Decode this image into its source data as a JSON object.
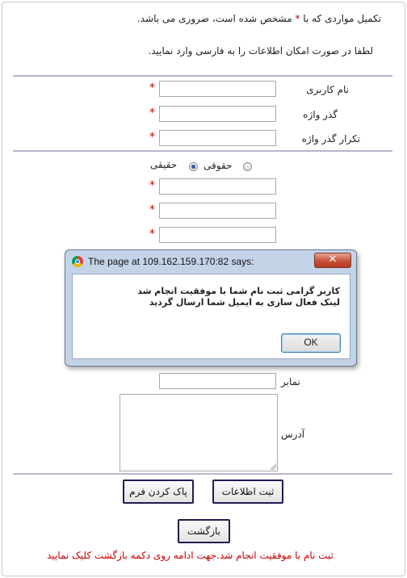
{
  "notice": {
    "line1_part1": "تکمیل مواردی که با",
    "star": "*",
    "line1_part2": "مشخص شده است، ضروری می باشد.",
    "line2": "لطفا در صورت امکان اطلاعات را به فارسی وارد نمایید."
  },
  "fields": {
    "username_label": "نام کاربری",
    "password_label": "گذر واژه",
    "password_repeat_label": "تکرار گذر واژه",
    "fax_label": "نمابر",
    "address_label": "آدرس",
    "required_mark": "*"
  },
  "person_type": {
    "legal": "حقوقی",
    "natural": "حقیقی",
    "selected": "حقیقی"
  },
  "buttons": {
    "clear": "پاک کردن فرم",
    "submit": "ثبت اطلاعات",
    "back": "بازگشت"
  },
  "status_message": "ثبت نام با موفقیت انجام شد.جهت ادامه روی دکمه بازگشت کلیک نمایید",
  "dialog": {
    "title": "The page at 109.162.159.170:82 says:",
    "close": "✕",
    "message_line1": "کاربر گرامی ثبت نام شما با موفقیت انجام شد",
    "message_line2": "لینک فعال سازی به ایمیل شما ارسال گردید",
    "ok": "OK"
  },
  "colors": {
    "required": "#cc0000",
    "separator": "#b8b6d0",
    "button_border": "#1e1e50"
  }
}
